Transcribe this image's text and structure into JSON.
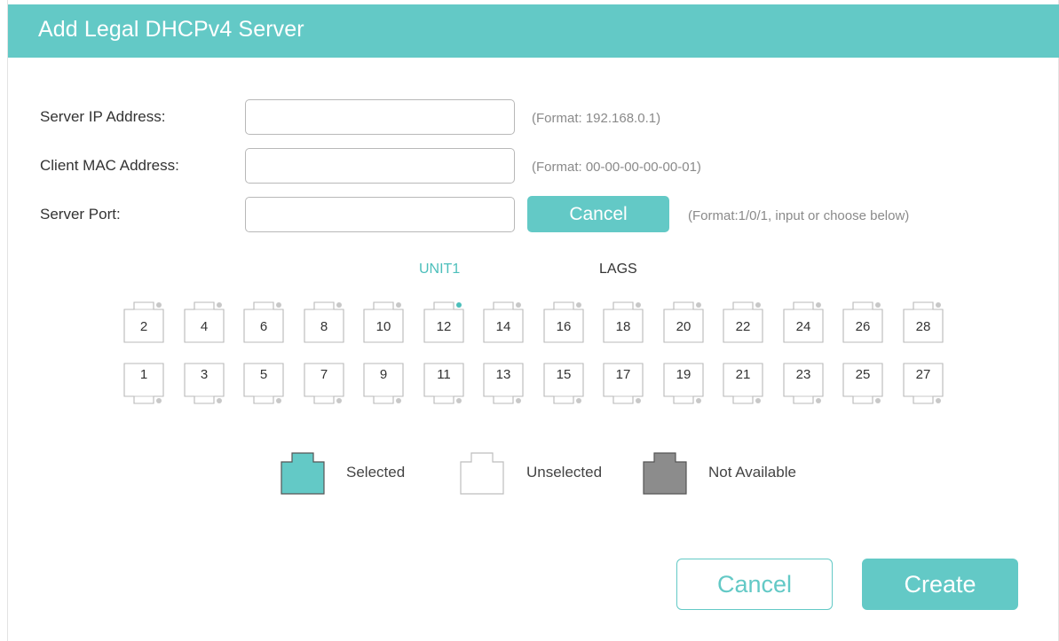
{
  "dialog": {
    "title": "Add Legal DHCPv4 Server"
  },
  "form": {
    "server_ip": {
      "label": "Server IP Address:",
      "value": "",
      "hint": "(Format: 192.168.0.1)"
    },
    "client_mac": {
      "label": "Client MAC Address:",
      "value": "",
      "hint": "(Format: 00-00-00-00-00-01)"
    },
    "server_port": {
      "label": "Server Port:",
      "value": "",
      "cancel_label": "Cancel",
      "hint": "(Format:1/0/1, input or choose below)"
    }
  },
  "tabs": [
    {
      "label": "UNIT1",
      "active": true
    },
    {
      "label": "LAGS",
      "active": false
    }
  ],
  "ports": {
    "top_row": [
      "2",
      "4",
      "6",
      "8",
      "10",
      "12",
      "14",
      "16",
      "18",
      "20",
      "22",
      "24",
      "26",
      "28"
    ],
    "bottom_row": [
      "1",
      "3",
      "5",
      "7",
      "9",
      "11",
      "13",
      "15",
      "17",
      "19",
      "21",
      "23",
      "25",
      "27"
    ],
    "link_up_port": "12"
  },
  "legend": {
    "selected": "Selected",
    "unselected": "Unselected",
    "not_available": "Not Available"
  },
  "footer": {
    "cancel_label": "Cancel",
    "create_label": "Create"
  },
  "colors": {
    "accent": "#63c9c6",
    "link_dot": "#4cbfbb",
    "idle_dot": "#c8c8c8",
    "not_available": "#8c8c8c"
  }
}
